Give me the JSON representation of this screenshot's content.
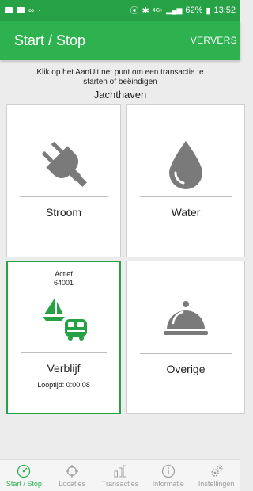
{
  "status_bar": {
    "network": "4G+",
    "battery": "62%",
    "time": "13:52"
  },
  "app_bar": {
    "title": "Start / Stop",
    "action_label": "VERVERS"
  },
  "intro_text": "Klik op het AanUit.net punt om een transactie te starten of beëindigen",
  "location": "Jachthaven",
  "tiles": [
    {
      "label": "Stroom",
      "icon": "plug-icon"
    },
    {
      "label": "Water",
      "icon": "water-drop-icon"
    },
    {
      "label": "Verblijf",
      "icon": "sailboat-and-camper-icon",
      "status": "Actief",
      "id": "64001",
      "runtime": "Looptijd: 0:00:08",
      "active": true
    },
    {
      "label": "Overige",
      "icon": "cloche-icon"
    }
  ],
  "bottom_nav": [
    {
      "label": "Start / Stop",
      "icon": "gauge-icon",
      "active": true
    },
    {
      "label": "Locaties",
      "icon": "crosshair-icon"
    },
    {
      "label": "Transacties",
      "icon": "bar-chart-icon"
    },
    {
      "label": "Informatie",
      "icon": "info-icon"
    },
    {
      "label": "Instellingen",
      "icon": "gears-icon"
    }
  ],
  "colors": {
    "brand_green": "#2eb24f",
    "status_bar_green": "#27a146",
    "icon_gray": "#7a7a7a"
  }
}
